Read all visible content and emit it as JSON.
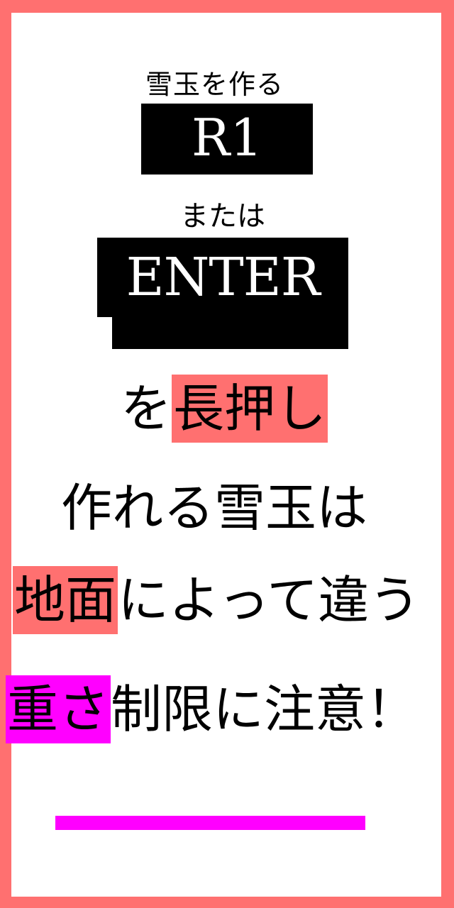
{
  "colors": {
    "frame": "#ff7070",
    "highlight_red": "#ff7070",
    "highlight_magenta": "#ff00ff",
    "key_box": "#000000",
    "text": "#000000"
  },
  "instruction": {
    "make_snowball": "雪玉を作る",
    "key1": "R1",
    "or": "または",
    "key2": "ENTER",
    "hold_prefix": "を",
    "hold_word": "長押し",
    "line_snowball_made": "作れる雪玉は",
    "ground_word": "地面",
    "ground_suffix": "によって違う",
    "weight_word": "重さ",
    "weight_suffix": "制限に注意！"
  }
}
